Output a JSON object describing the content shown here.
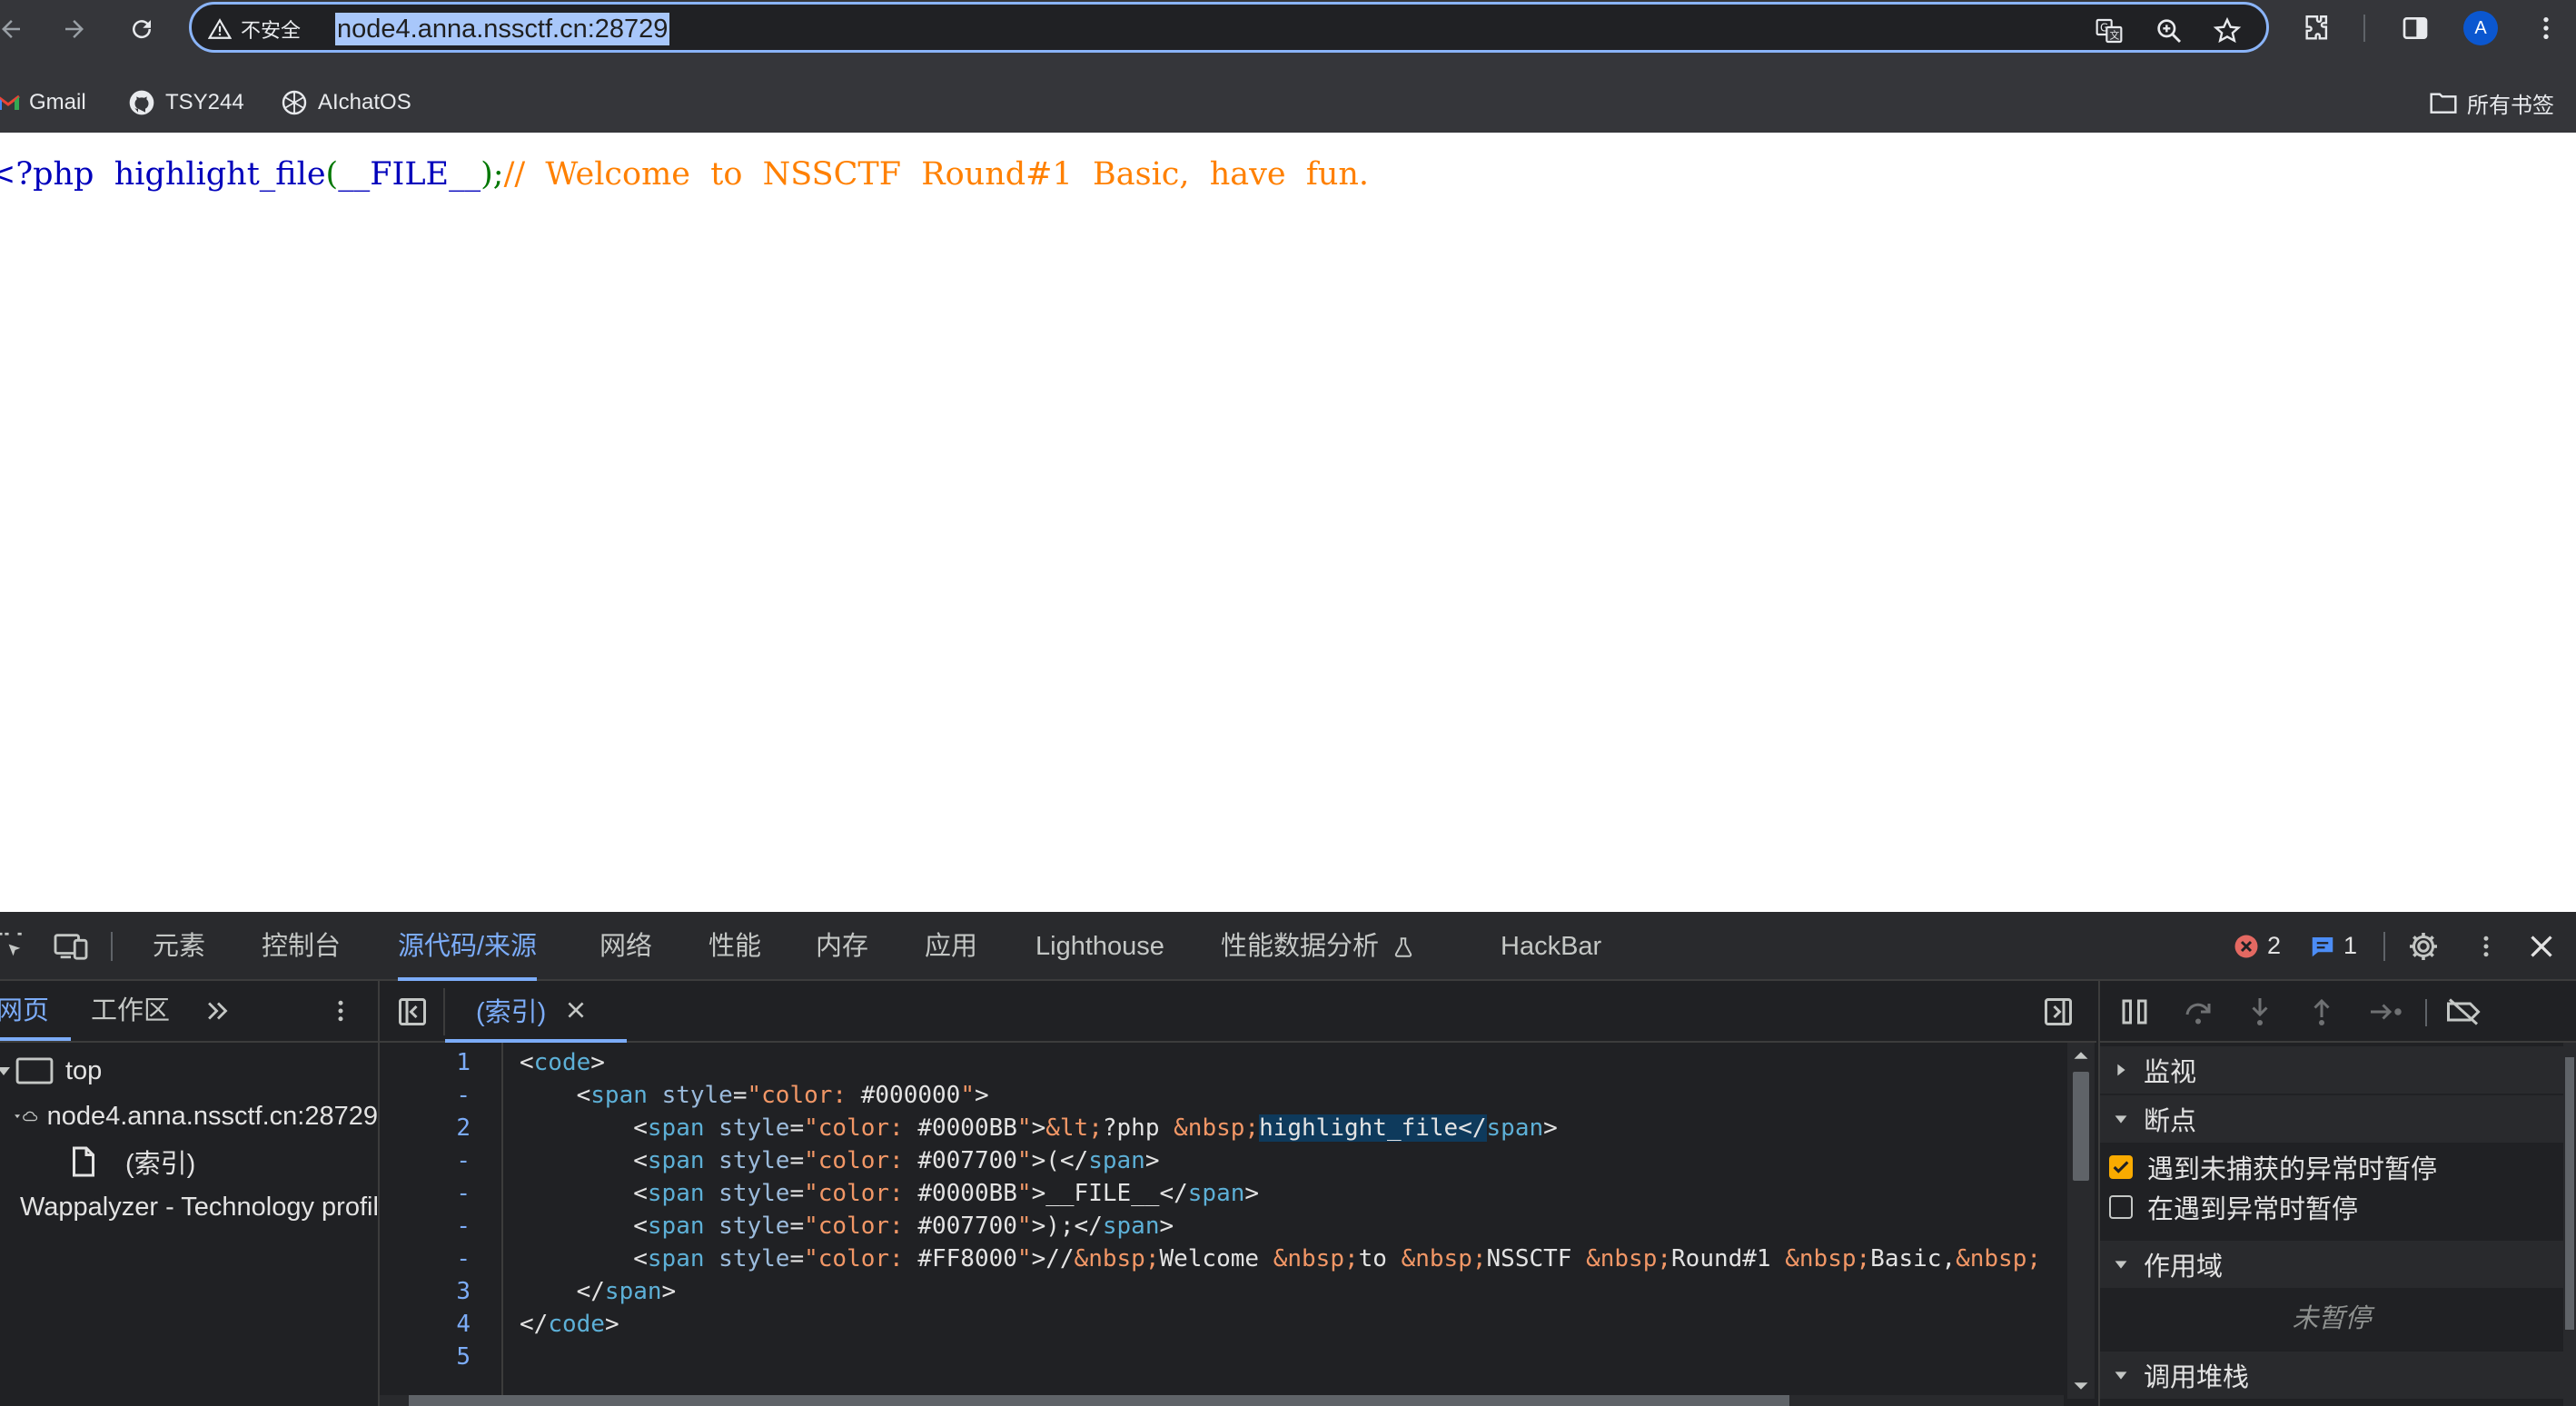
{
  "browser": {
    "security_label": "不安全",
    "url": "node4.anna.nssctf.cn:28729",
    "profile_initial": "A",
    "bookmarks": [
      "Gmail",
      "TSY244",
      "AIchatOS"
    ],
    "all_bookmarks_label": "所有书签"
  },
  "page": {
    "code_tokens": [
      {
        "text": "<?php  ",
        "color": "#0000BB"
      },
      {
        "text": "highlight_file",
        "color": "#0000BB"
      },
      {
        "text": "(",
        "color": "#007700"
      },
      {
        "text": "__FILE__",
        "color": "#0000BB"
      },
      {
        "text": ");",
        "color": "#007700"
      },
      {
        "text": "//  Welcome  to  NSSCTF  Round#1  Basic,  have  fun.",
        "color": "#FF8000"
      }
    ]
  },
  "devtools": {
    "tabs": [
      "元素",
      "控制台",
      "源代码/来源",
      "网络",
      "性能",
      "内存",
      "应用",
      "Lighthouse",
      "性能数据分析",
      "HackBar"
    ],
    "active_tab": "源代码/来源",
    "error_count": "2",
    "message_count": "1",
    "navigator": {
      "tabs": [
        "网页",
        "工作区"
      ],
      "tree": [
        "top",
        "node4.anna.nssctf.cn:28729",
        "(索引)",
        "Wappalyzer - Technology profiler"
      ]
    },
    "editor": {
      "file_tab": "(索引)",
      "gutter": [
        "1",
        "-",
        "2",
        "-",
        "-",
        "-",
        "-",
        "3",
        "4",
        "5"
      ]
    },
    "debugger": {
      "sections": {
        "watch": "监视",
        "breakpoints": "断点",
        "scope": "作用域",
        "call_stack": "调用堆栈"
      },
      "pause_uncaught": "遇到未捕获的异常时暂停",
      "pause_caught": "在遇到异常时暂停",
      "not_paused": "未暂停"
    }
  }
}
